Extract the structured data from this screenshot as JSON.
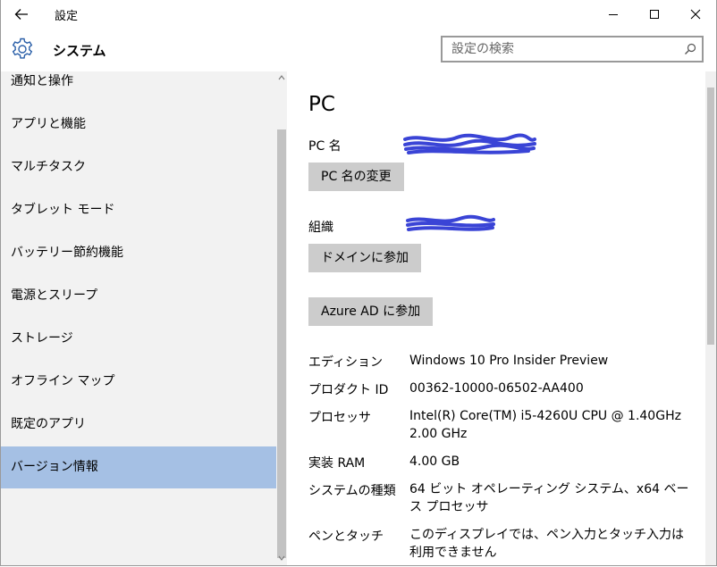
{
  "titlebar": {
    "title": "設定"
  },
  "header": {
    "title": "システム"
  },
  "search": {
    "placeholder": "設定の検索"
  },
  "sidebar": {
    "items": [
      {
        "label": "通知と操作",
        "selected": false
      },
      {
        "label": "アプリと機能",
        "selected": false
      },
      {
        "label": "マルチタスク",
        "selected": false
      },
      {
        "label": "タブレット モード",
        "selected": false
      },
      {
        "label": "バッテリー節約機能",
        "selected": false
      },
      {
        "label": "電源とスリープ",
        "selected": false
      },
      {
        "label": "ストレージ",
        "selected": false
      },
      {
        "label": "オフライン マップ",
        "selected": false
      },
      {
        "label": "既定のアプリ",
        "selected": false
      },
      {
        "label": "バージョン情報",
        "selected": true
      }
    ]
  },
  "main": {
    "title": "PC",
    "pc_name_label": "PC 名",
    "rename_button": "PC 名の変更",
    "org_label": "組織",
    "join_domain_button": "ドメインに参加",
    "join_azure_button": "Azure AD に参加",
    "info": [
      {
        "label": "エディション",
        "value": "Windows 10 Pro Insider Preview"
      },
      {
        "label": "プロダクト ID",
        "value": "00362-10000-06502-AA400"
      },
      {
        "label": "プロセッサ",
        "value": "Intel(R) Core(TM) i5-4260U CPU @ 1.40GHz 2.00 GHz"
      },
      {
        "label": "実装 RAM",
        "value": "4.00 GB"
      },
      {
        "label": "システムの種類",
        "value": "64 ビット オペレーティング システム、x64 ベース プロセッサ"
      },
      {
        "label": "ペンとタッチ",
        "value": "このディスプレイでは、ペン入力とタッチ入力は利用できません"
      }
    ]
  },
  "colors": {
    "selected_bg": "#a5c0e4",
    "sidebar_bg": "#f2f2f2",
    "button_bg": "#cccccc",
    "redaction": "#3a44d6"
  }
}
